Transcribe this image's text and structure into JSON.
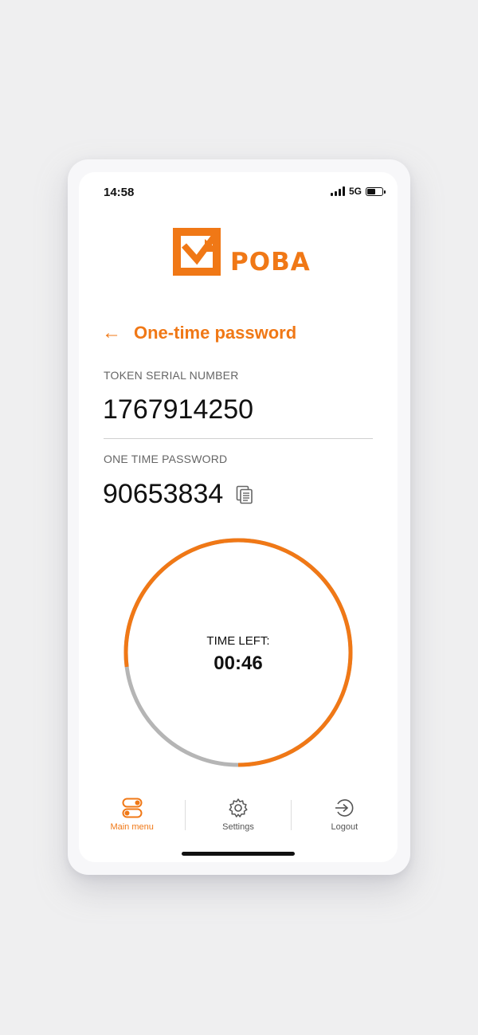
{
  "status_bar": {
    "time": "14:58",
    "network": "5G"
  },
  "logo": {
    "text": "POBA",
    "icon": "poba-logo-icon"
  },
  "header": {
    "back_icon": "←",
    "title": "One-time password"
  },
  "token": {
    "label": "TOKEN SERIAL NUMBER",
    "value": "1767914250"
  },
  "otp": {
    "label": "ONE TIME PASSWORD",
    "value": "90653834",
    "copy_icon": "copy-icon"
  },
  "timer": {
    "label": "TIME LEFT:",
    "value": "00:46",
    "progress_fraction": 0.77,
    "progress_color": "#f07816",
    "track_color": "#b5b5b5"
  },
  "nav": {
    "items": [
      {
        "label": "Main menu",
        "icon": "toggles-icon",
        "active": true
      },
      {
        "label": "Settings",
        "icon": "gear-icon",
        "active": false
      },
      {
        "label": "Logout",
        "icon": "logout-icon",
        "active": false
      }
    ]
  },
  "colors": {
    "accent": "#f07816",
    "text": "#111111",
    "muted": "#666666"
  }
}
